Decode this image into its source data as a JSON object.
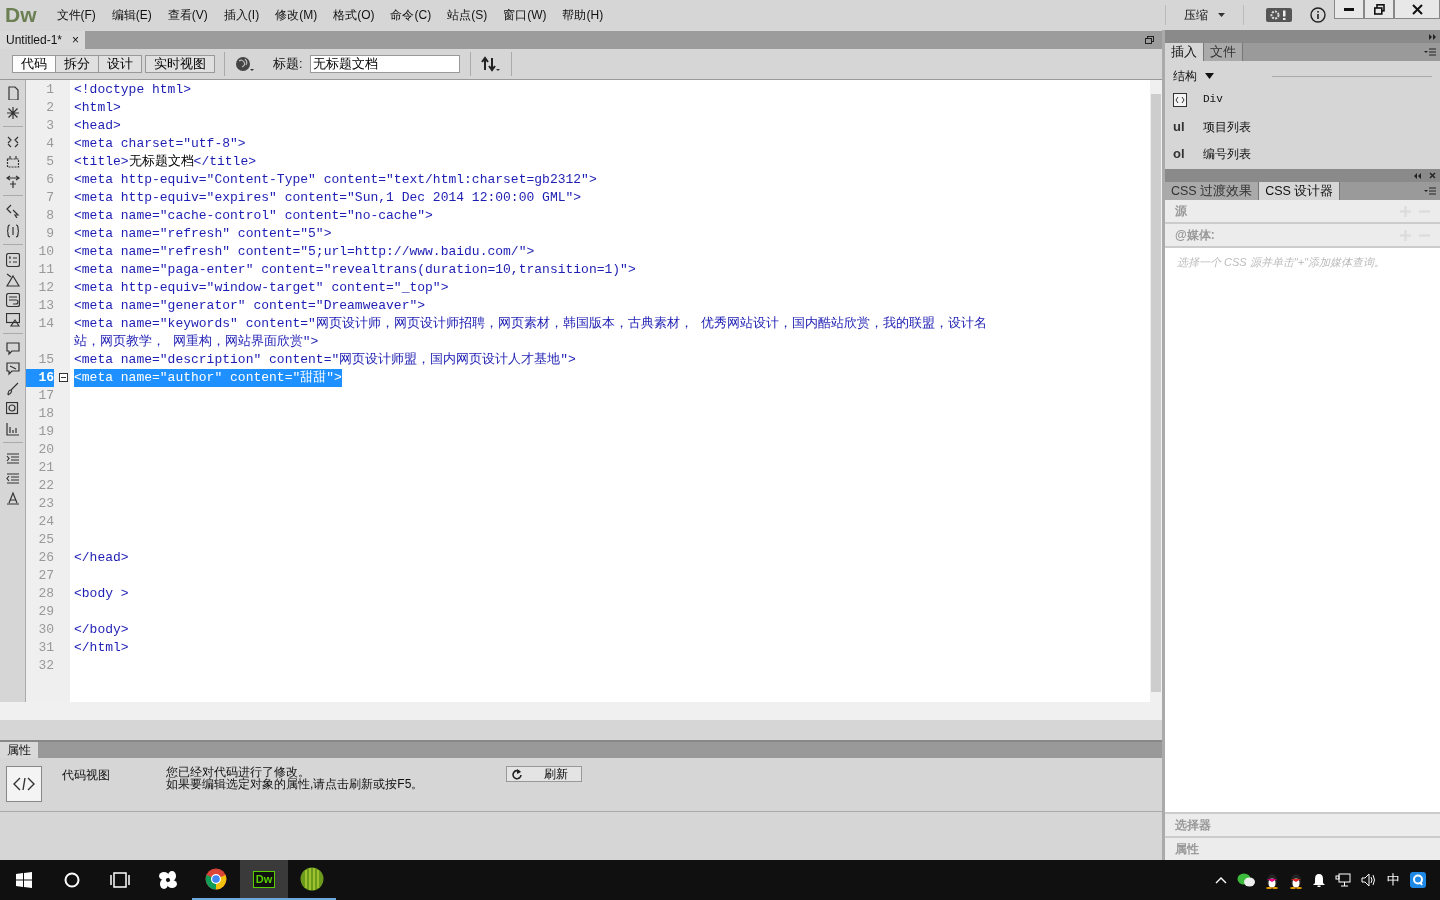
{
  "app": {
    "logo": "Dw",
    "menu": [
      "文件(F)",
      "编辑(E)",
      "查看(V)",
      "插入(I)",
      "修改(M)",
      "格式(O)",
      "命令(C)",
      "站点(S)",
      "窗口(W)",
      "帮助(H)"
    ],
    "workspace": "压缩"
  },
  "document_tabs": [
    {
      "label": "Untitled-1*",
      "selected": true,
      "close": "×"
    }
  ],
  "view_buttons": [
    {
      "label": "代码",
      "selected": true
    },
    {
      "label": "拆分",
      "selected": false
    },
    {
      "label": "设计",
      "selected": false
    },
    {
      "label": "实时视图",
      "selected": false
    }
  ],
  "title_field": {
    "label": "标题:",
    "value": "无标题文档"
  },
  "code": {
    "lines": [
      {
        "number": "1",
        "text": "<!doctype html>",
        "selected": false
      },
      {
        "number": "2",
        "text": "<html>",
        "selected": false
      },
      {
        "number": "3",
        "text": "<head>",
        "selected": false
      },
      {
        "number": "4",
        "text": "<meta charset=\"utf-8\">",
        "selected": false
      },
      {
        "number": "5",
        "parts": [
          {
            "kind": "tag",
            "text": "<title>"
          },
          {
            "kind": "text",
            "text": "无标题文档"
          },
          {
            "kind": "tag",
            "text": "</title>"
          }
        ],
        "selected": false
      },
      {
        "number": "6",
        "text": "<meta http-equiv=\"Content-Type\" content=\"text/html:charset=gb2312\">",
        "selected": false
      },
      {
        "number": "7",
        "text": "<meta http-equiv=\"expires\" content=\"Sun,1 Dec 2014 12:00:00 GML\">",
        "selected": false
      },
      {
        "number": "8",
        "text": "<meta name=\"cache-control\" content=\"no-cache\">",
        "selected": false
      },
      {
        "number": "9",
        "text": "<meta name=\"refresh\" content=\"5\">",
        "selected": false
      },
      {
        "number": "10",
        "text": "<meta name=\"refresh\" content=\"5;url=http://www.baidu.com/\">",
        "selected": false
      },
      {
        "number": "11",
        "text": "<meta name=\"paga-enter\" content=\"revealtrans(duration=10,transition=1)\">",
        "selected": false
      },
      {
        "number": "12",
        "text": "<meta http-equiv=\"window-target\" content=\"_top\">",
        "selected": false
      },
      {
        "number": "13",
        "text": "<meta name=\"generator\" content=\"Dreamweaver\">",
        "selected": false
      },
      {
        "number": "14",
        "text": "<meta name=\"keywords\" content=\"网页设计师，网页设计师招聘，网页素材，韩国版本，古典素材， 优秀网站设计，国内酷站欣赏，我的联盟，设计名站，网页教学， 网重构，网站界面欣赏\">",
        "selected": false
      },
      {
        "number": "15",
        "text": "<meta name=\"description\" content=\"网页设计师盟，国内网页设计人才基地\">",
        "selected": false
      },
      {
        "number": "16",
        "text": "<meta name=\"author\" content=\"甜甜\">",
        "selected": true
      },
      {
        "number": "17",
        "selected": false
      },
      {
        "number": "18",
        "selected": false
      },
      {
        "number": "19",
        "selected": false
      },
      {
        "number": "20",
        "selected": false
      },
      {
        "number": "21",
        "selected": false
      },
      {
        "number": "22",
        "selected": false
      },
      {
        "number": "23",
        "selected": false
      },
      {
        "number": "24",
        "selected": false
      },
      {
        "number": "25",
        "selected": false
      },
      {
        "number": "26",
        "text": "</head>",
        "selected": false
      },
      {
        "number": "27",
        "selected": false
      },
      {
        "number": "28",
        "text": "<body >",
        "selected": false
      },
      {
        "number": "29",
        "selected": false
      },
      {
        "number": "30",
        "text": "</body>",
        "selected": false
      },
      {
        "number": "31",
        "text": "</html>",
        "selected": false
      },
      {
        "number": "32",
        "selected": false
      }
    ]
  },
  "properties": {
    "tab": "属性",
    "mode": "代码视图",
    "message": [
      "您已经对代码进行了修改。",
      "如果要编辑选定对象的属性,请点击刷新或按F5。"
    ],
    "refresh_button": "刷新"
  },
  "insert_panel": {
    "tabs": [
      {
        "label": "插入",
        "selected": true
      },
      {
        "label": "文件",
        "selected": false
      }
    ],
    "category": "结构",
    "items": [
      {
        "kind": "icon",
        "label": "Div"
      },
      {
        "kind": "tag",
        "tag": "ul",
        "label": "项目列表"
      },
      {
        "kind": "tag",
        "tag": "ol",
        "label": "编号列表"
      }
    ]
  },
  "css_panel": {
    "tabs": [
      {
        "label": "CSS 过渡效果",
        "selected": false
      },
      {
        "label": "CSS 设计器",
        "selected": true
      }
    ],
    "sections": [
      "源",
      "@媒体:"
    ],
    "hint": "选择一个 CSS 源并单击\"+\"添加媒体查询。",
    "bottom_sections": [
      "选择器",
      "属性"
    ]
  },
  "taskbar": {
    "apps": [
      {
        "kind": "pinwheel",
        "running": false,
        "selected": false
      },
      {
        "kind": "chrome",
        "running": true,
        "selected": false
      },
      {
        "kind": "dw",
        "label": "Dw",
        "running": true,
        "selected": true
      },
      {
        "kind": "melon",
        "running": true,
        "selected": false
      }
    ],
    "ime": "中"
  }
}
